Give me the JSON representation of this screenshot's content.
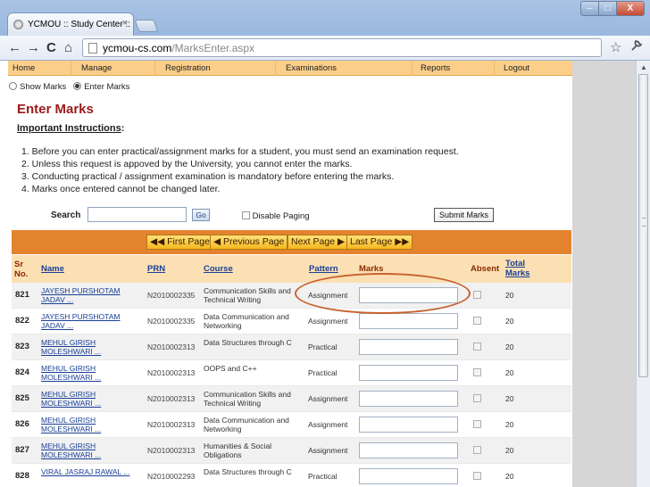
{
  "browser": {
    "tab_title": "YCMOU :: Study Center :: D",
    "tab_close": "×",
    "url_host": "ycmou-cs.com",
    "url_path": "/MarksEnter.aspx",
    "back": "←",
    "forward": "→",
    "reload": "C",
    "home": "⌂",
    "star": "☆",
    "wrench": "🔧",
    "min": "–",
    "max": "□",
    "close": "X"
  },
  "menu": [
    {
      "label": "Home"
    },
    {
      "label": "Manage"
    },
    {
      "label": "Registration"
    },
    {
      "label": "Examinations"
    },
    {
      "label": "Reports"
    },
    {
      "label": "Logout"
    }
  ],
  "view": {
    "show_marks": "Show Marks",
    "enter_marks": "Enter Marks",
    "selected": "Enter Marks"
  },
  "page_title": "Enter Marks",
  "instructions": {
    "heading": "Important Instructions",
    "colon": ":",
    "items": [
      "1. Before you can enter practical/assignment marks for a student, you must send an examination request.",
      "2. Unless this request is appoved by the University, you cannot enter the marks.",
      "3. Conducting practical / assignment examination is mandatory before entering the marks.",
      "4. Marks once entered cannot be changed later."
    ]
  },
  "search": {
    "label": "Search",
    "value": "",
    "go": "Go",
    "disable_paging": "Disable Paging",
    "submit": "Submit Marks"
  },
  "pager": {
    "first": "◀◀ First Page",
    "previous": "◀ Previous Page",
    "next": "Next Page ▶",
    "last": "Last Page ▶▶"
  },
  "columns": {
    "sr1": "Sr",
    "sr2": "No.",
    "name": "Name",
    "prn": "PRN",
    "course": "Course",
    "pattern": "Pattern",
    "marks": "Marks",
    "absent": "Absent",
    "total1": "Total",
    "total2": "Marks"
  },
  "rows": [
    {
      "sr": "821",
      "name1": "JAYESH PURSHOTAM",
      "name2": "JADAV ...",
      "prn": "N2010002335",
      "course1": "Communication Skills and",
      "course2": "Technical Writing",
      "pattern": "Assignment",
      "marks": "",
      "total": "20"
    },
    {
      "sr": "822",
      "name1": "JAYESH PURSHOTAM",
      "name2": "JADAV ...",
      "prn": "N2010002335",
      "course1": "Data Communication and",
      "course2": "Networking",
      "pattern": "Assignment",
      "marks": "",
      "total": "20"
    },
    {
      "sr": "823",
      "name1": "MEHUL GIRISH",
      "name2": "MOLESHWARI ...",
      "prn": "N2010002313",
      "course1": "Data Structures through C",
      "course2": "",
      "pattern": "Practical",
      "marks": "",
      "total": "20"
    },
    {
      "sr": "824",
      "name1": "MEHUL GIRISH",
      "name2": "MOLESHWARI ...",
      "prn": "N2010002313",
      "course1": "OOPS and C++",
      "course2": "",
      "pattern": "Practical",
      "marks": "",
      "total": "20"
    },
    {
      "sr": "825",
      "name1": "MEHUL GIRISH",
      "name2": "MOLESHWARI ...",
      "prn": "N2010002313",
      "course1": "Communication Skills and",
      "course2": "Technical Writing",
      "pattern": "Assignment",
      "marks": "",
      "total": "20"
    },
    {
      "sr": "826",
      "name1": "MEHUL GIRISH",
      "name2": "MOLESHWARI ...",
      "prn": "N2010002313",
      "course1": "Data Communication and",
      "course2": "Networking",
      "pattern": "Assignment",
      "marks": "",
      "total": "20"
    },
    {
      "sr": "827",
      "name1": "MEHUL GIRISH",
      "name2": "MOLESHWARI ...",
      "prn": "N2010002313",
      "course1": "Humanities & Social",
      "course2": "Obligations",
      "pattern": "Assignment",
      "marks": "",
      "total": "20"
    },
    {
      "sr": "828",
      "name1": "VIRAL JASRAJ RAWAL ...",
      "name2": "",
      "prn": "N2010002293",
      "course1": "Data Structures through C",
      "course2": "",
      "pattern": "Practical",
      "marks": "",
      "total": "20"
    }
  ],
  "colors": {
    "menu_bg": "#fbcf8a",
    "pager_bg": "#e4832e",
    "title": "#9b1b1b",
    "link": "#1a3f96",
    "highlight": "#c8622e"
  }
}
